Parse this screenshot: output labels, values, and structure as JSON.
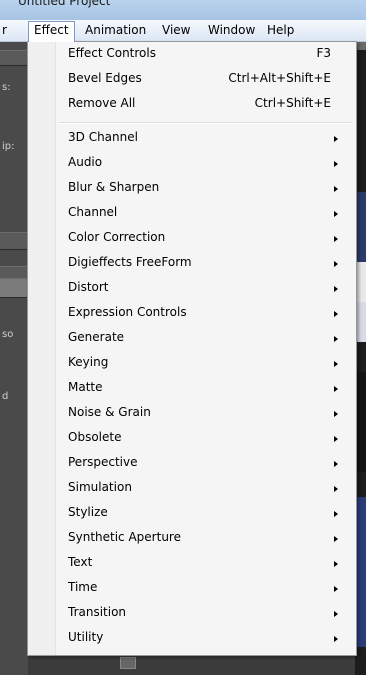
{
  "window": {
    "title": "Untitled Project"
  },
  "menubar": {
    "items": [
      {
        "label": "r"
      },
      {
        "label": "Effect"
      },
      {
        "label": "Animation"
      },
      {
        "label": "View"
      },
      {
        "label": "Window"
      },
      {
        "label": "Help"
      }
    ]
  },
  "menu": {
    "top_items": [
      {
        "label": "Effect Controls",
        "shortcut": "F3"
      },
      {
        "label": "Bevel Edges",
        "shortcut": "Ctrl+Alt+Shift+E"
      },
      {
        "label": "Remove All",
        "shortcut": "Ctrl+Shift+E"
      }
    ],
    "categories": [
      {
        "label": "3D Channel"
      },
      {
        "label": "Audio"
      },
      {
        "label": "Blur & Sharpen"
      },
      {
        "label": "Channel"
      },
      {
        "label": "Color Correction"
      },
      {
        "label": "Digieffects FreeForm"
      },
      {
        "label": "Distort"
      },
      {
        "label": "Expression Controls"
      },
      {
        "label": "Generate"
      },
      {
        "label": "Keying"
      },
      {
        "label": "Matte"
      },
      {
        "label": "Noise & Grain"
      },
      {
        "label": "Obsolete"
      },
      {
        "label": "Perspective"
      },
      {
        "label": "Simulation"
      },
      {
        "label": "Stylize"
      },
      {
        "label": "Synthetic Aperture"
      },
      {
        "label": "Text"
      },
      {
        "label": "Time"
      },
      {
        "label": "Transition"
      },
      {
        "label": "Utility"
      }
    ]
  },
  "background": {
    "left_labels": [
      "s:",
      "ip:",
      "so",
      "d"
    ]
  },
  "colors": {
    "menu_bg": "#f5f5f5",
    "menubar_bg": "#dbe6f4",
    "app_dark": "#3a3a3a"
  },
  "icons": {
    "submenu_indicator": "triangle-right-icon"
  }
}
